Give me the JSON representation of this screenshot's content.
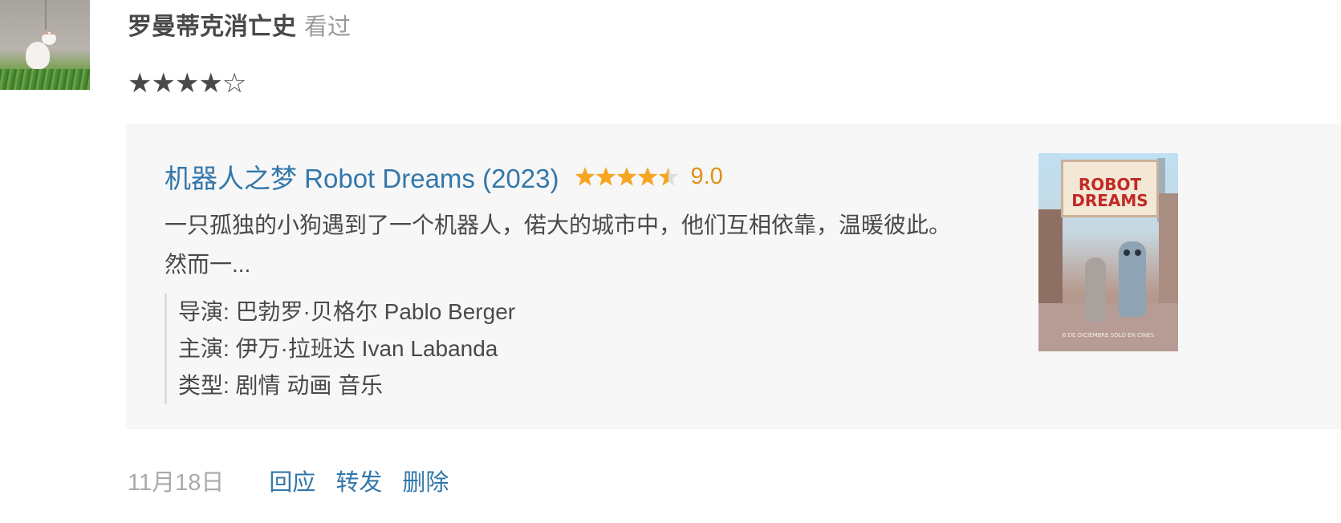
{
  "user": {
    "name": "罗曼蒂克消亡史",
    "action": "看过",
    "rating_stars": "★★★★☆",
    "rating_value": 4,
    "rating_max": 5
  },
  "card": {
    "title": "机器人之梦 Robot Dreams (2023)",
    "stars_value": 4.5,
    "stars_max": 5,
    "score": "9.0",
    "description": "一只孤独的小狗遇到了一个机器人，偌大的城市中，他们互相依靠，温暖彼此。然而一...",
    "meta": {
      "director": "导演: 巴勃罗·贝格尔 Pablo Berger",
      "cast": "主演: 伊万·拉班达 Ivan Labanda",
      "genre": "类型: 剧情 动画 音乐"
    },
    "poster": {
      "title_line1": "ROBOT",
      "title_line2": "DREAMS",
      "caption": "6 DE DICIEMBRE SOLO EN CINES"
    }
  },
  "footer": {
    "time": "11月18日",
    "reply": "回应",
    "forward": "转发",
    "delete": "删除"
  },
  "colors": {
    "link": "#3377aa",
    "score": "#e09015",
    "star": "#f5a623",
    "card_bg": "#f7f7f7"
  }
}
